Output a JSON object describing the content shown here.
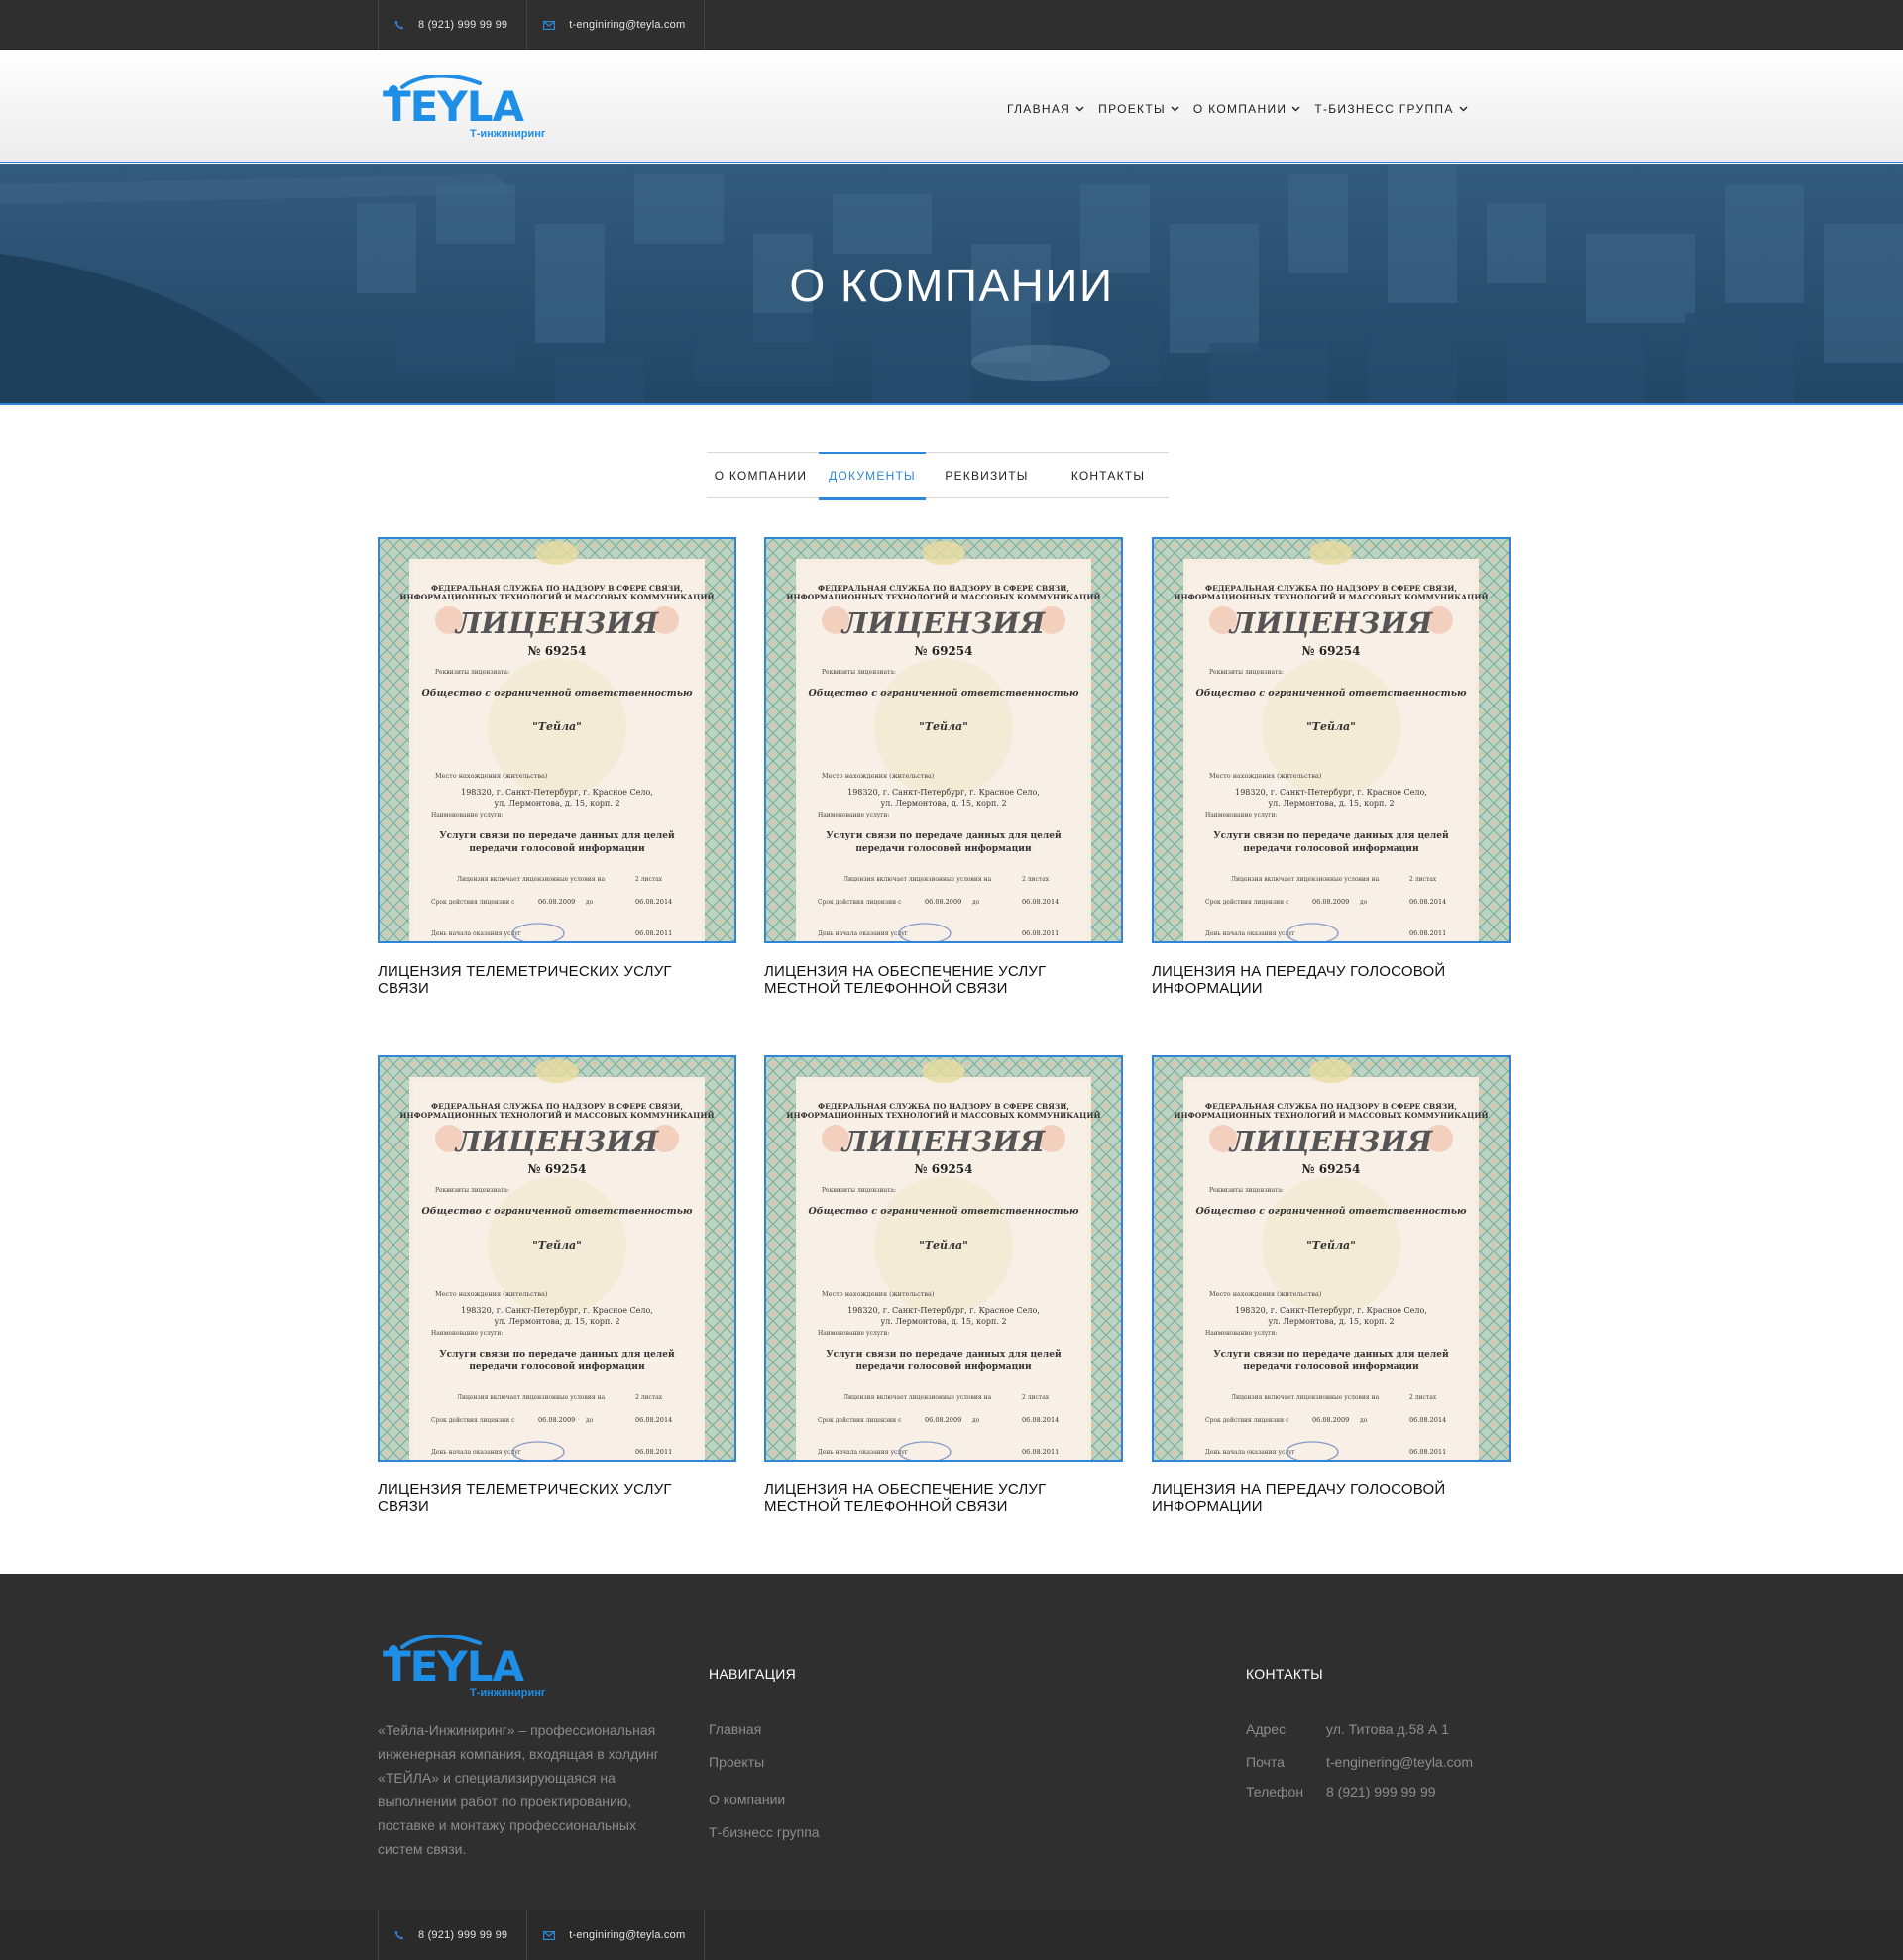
{
  "contact_bar": {
    "phone": "8 (921) 999 99 99",
    "email": "t-enginiring@teyla.com",
    "phone_icon": "phone-icon",
    "email_icon": "envelope-icon"
  },
  "logo": {
    "brand": "TEYLA",
    "tagline": "Т-инжиниринг"
  },
  "nav": {
    "items": [
      {
        "label": "ГЛАВНАЯ"
      },
      {
        "label": "ПРОЕКТЫ"
      },
      {
        "label": "О КОМПАНИИ"
      },
      {
        "label": "Т-БИЗНЕСС ГРУППА"
      }
    ],
    "dropdown_icon": "chevron-down-icon"
  },
  "hero": {
    "title": "О КОМПАНИИ"
  },
  "tabs": [
    {
      "label": "О КОМПАНИИ",
      "active": false
    },
    {
      "label": "ДОКУМЕНТЫ",
      "active": true
    },
    {
      "label": "РЕКВИЗИТЫ",
      "active": false
    },
    {
      "label": "КОНТАКТЫ",
      "active": false
    }
  ],
  "license_doc": {
    "agency": "ФЕДЕРАЛЬНАЯ СЛУЖБА ПО НАДЗОРУ В СФЕРЕ СВЯЗИ, ИНФОРМАЦИОННЫХ ТЕХНОЛОГИЙ И МАССОВЫХ КОММУНИКАЦИЙ",
    "agency_line1": "ФЕДЕРАЛЬНАЯ СЛУЖБА ПО НАДЗОРУ В СФЕРЕ СВЯЗИ,",
    "agency_line2": "ИНФОРМАЦИОННЫХ ТЕХНОЛОГИЙ И МАССОВЫХ КОММУНИКАЦИЙ",
    "heading": "ЛИЦЕНЗИЯ",
    "number": "№ 69254",
    "requisites_label": "Реквизиты лицензиата:",
    "org_type": "Общество с ограниченной ответственностью",
    "org_name": "\"Тейла\"",
    "location_label": "Место нахождения (жительства)",
    "address_line1": "198320, г. Санкт-Петербург, г. Красное Село,",
    "address_line2": "ул. Лермонтова, д. 15, корп. 2",
    "services_label": "Наименование услуги:",
    "service_line1": "Услуги связи по передаче данных для целей",
    "service_line2": "передачи голосовой информации",
    "conditions": "Лицензия включает лицензионные условия на",
    "sheets": "2 листах",
    "validity_label": "Срок действия лицензии с",
    "date_from": "06.08.2009",
    "to_word": "до",
    "date_to": "06.08.2014",
    "start_label": "День начала оказания услуг",
    "start_date": "06.08.2011"
  },
  "documents": [
    {
      "title": "ЛИЦЕНЗИЯ ТЕЛЕМЕТРИЧЕСКИХ УСЛУГ СВЯЗИ"
    },
    {
      "title": "ЛИЦЕНЗИЯ НА ОБЕСПЕЧЕНИЕ УСЛУГ МЕСТНОЙ ТЕЛЕФОННОЙ СВЯЗИ"
    },
    {
      "title": "ЛИЦЕНЗИЯ НА ПЕРЕДАЧУ ГОЛОСОВОЙ ИНФОРМАЦИИ"
    },
    {
      "title": "ЛИЦЕНЗИЯ ТЕЛЕМЕТРИЧЕСКИХ УСЛУГ СВЯЗИ"
    },
    {
      "title": "ЛИЦЕНЗИЯ НА ОБЕСПЕЧЕНИЕ УСЛУГ МЕСТНОЙ ТЕЛЕФОННОЙ СВЯЗИ"
    },
    {
      "title": "ЛИЦЕНЗИЯ НА ПЕРЕДАЧУ ГОЛОСОВОЙ ИНФОРМАЦИИ"
    }
  ],
  "footer": {
    "about": "«Тейла-Инжиниринг» – профессиональная инженерная компания, входящая в холдинг «ТЕЙЛА» и специализирующаяся на выполнении работ по проектированию, поставке и монтажу профессиональных систем связи.",
    "nav_heading": "НАВИГАЦИЯ",
    "nav_links": [
      "Главная",
      "Проекты",
      "О компании",
      "Т-бизнесс группа"
    ],
    "contacts_heading": "КОНТАКТЫ",
    "contacts": [
      {
        "label": "Адрес",
        "value": "ул. Титова д.58 А 1"
      },
      {
        "label": "Почта",
        "value": "t-enginering@teyla.com"
      },
      {
        "label": "Телефон",
        "value": "8 (921) 999 99 99"
      }
    ]
  },
  "colors": {
    "accent": "#2f86d8",
    "logo_blue": "#1f8ee6",
    "dark_bar": "#2f2f2f",
    "hero_tint": "#2f5576"
  }
}
